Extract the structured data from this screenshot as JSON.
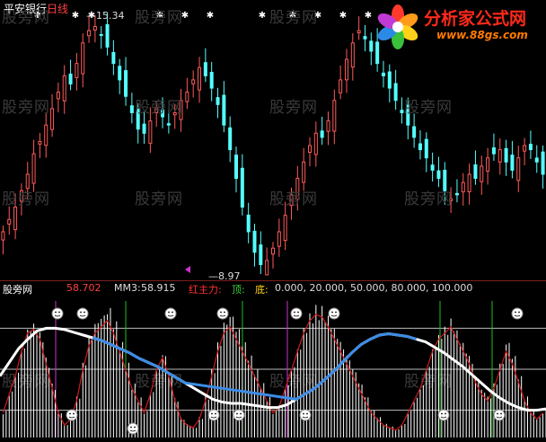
{
  "stock": {
    "name": "平安银行",
    "period": "日线"
  },
  "price_annotations": {
    "high": "15.34",
    "low": "8.97"
  },
  "indicator_legend": {
    "panel_name": "股旁网",
    "main_value": "58.702",
    "mm3_label": "MM3:",
    "mm3_value": "58.915",
    "zhuli_label": "红主力:",
    "top_label": "顶:",
    "bottom_label": "底:",
    "levels": "0.000, 20.000, 50.000, 80.000, 100.000"
  },
  "watermark": "股旁网",
  "brand": {
    "name": "分析家公式网",
    "url": "www.88gs.com"
  },
  "colors": {
    "up_candle": "#ff5a5a",
    "down_candle": "#54ffff",
    "indicator_white": "#ffffff",
    "indicator_blue": "#3c8ce6",
    "indicator_red": "#d01a1a",
    "level_green": "#1fbf1f",
    "level_magenta": "#cc33cc"
  },
  "chart_data": {
    "type": "candlestick",
    "price_high": 15.34,
    "price_low": 8.97,
    "close": [
      10.0,
      10.3,
      10.6,
      11.0,
      11.4,
      11.9,
      12.2,
      12.6,
      13.0,
      13.4,
      13.8,
      13.6,
      14.1,
      14.6,
      14.9,
      15.0,
      14.8,
      14.5,
      14.1,
      13.7,
      13.3,
      12.9,
      12.5,
      12.4,
      12.7,
      13.0,
      12.8,
      12.6,
      12.9,
      13.2,
      13.4,
      13.7,
      14.0,
      13.8,
      13.5,
      13.1,
      12.6,
      12.0,
      11.3,
      10.6,
      10.0,
      9.5,
      9.2,
      9.3,
      9.6,
      10.0,
      10.4,
      10.9,
      11.3,
      11.7,
      12.1,
      12.4,
      12.3,
      12.7,
      13.2,
      13.7,
      14.2,
      14.6,
      14.9,
      14.7,
      14.4,
      14.1,
      13.8,
      13.5,
      13.2,
      12.9,
      12.6,
      12.3,
      12.0,
      11.8,
      11.5,
      11.3,
      11.0,
      10.8,
      10.9,
      11.2,
      11.4,
      11.3,
      11.6,
      11.8,
      11.9,
      12.0,
      11.7,
      11.5,
      11.8,
      12.1,
      12.0,
      11.7,
      11.4
    ],
    "indicator_main_approx": [
      20,
      35,
      50,
      70,
      85,
      88,
      80,
      60,
      40,
      20,
      10,
      15,
      30,
      55,
      75,
      85,
      90,
      95,
      85,
      70,
      55,
      40,
      30,
      20,
      35,
      55,
      65,
      50,
      30,
      15,
      10,
      8,
      15,
      30,
      50,
      70,
      85,
      90,
      80,
      70,
      60,
      50,
      40,
      30,
      20,
      25,
      40,
      55,
      70,
      85,
      95,
      100,
      98,
      90,
      80,
      70,
      60,
      50,
      40,
      30,
      20,
      15,
      10,
      8,
      6,
      10,
      20,
      30,
      40,
      55,
      70,
      80,
      85,
      90,
      80,
      70,
      60,
      45,
      35,
      30,
      40,
      55,
      70,
      60,
      45,
      30,
      20,
      15,
      20
    ],
    "indicator_blue_approx": [
      45,
      55,
      65,
      72,
      78,
      80,
      80,
      79,
      77,
      75,
      73,
      71,
      68,
      65,
      62,
      58,
      55,
      52,
      48,
      44,
      40,
      36,
      32,
      28,
      26,
      25,
      25,
      24,
      23,
      22,
      22,
      24,
      28,
      32,
      36,
      42,
      48,
      55,
      62,
      68,
      72,
      75,
      76,
      75,
      74,
      72,
      70,
      66,
      62,
      57,
      52,
      46,
      40,
      34,
      29,
      25,
      22,
      20,
      20,
      21
    ],
    "levels": [
      0,
      20,
      50,
      80,
      100
    ]
  }
}
